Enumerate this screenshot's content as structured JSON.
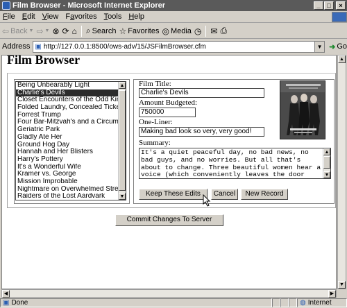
{
  "window": {
    "title": "Film Browser - Microsoft Internet Explorer",
    "buttons": {
      "minimize": "_",
      "maximize": "□",
      "close": "×"
    }
  },
  "menu": [
    {
      "prefix": "",
      "underline": "F",
      "rest": "ile"
    },
    {
      "prefix": "",
      "underline": "E",
      "rest": "dit"
    },
    {
      "prefix": "",
      "underline": "V",
      "rest": "iew"
    },
    {
      "prefix": "F",
      "underline": "a",
      "rest": "vorites"
    },
    {
      "prefix": "",
      "underline": "T",
      "rest": "ools"
    },
    {
      "prefix": "",
      "underline": "H",
      "rest": "elp"
    }
  ],
  "toolbar": {
    "back_label": "Back",
    "search_label": "Search",
    "favorites_label": "Favorites",
    "media_label": "Media"
  },
  "address": {
    "label": "Address",
    "url": "http://127.0.0.1:8500/ows-adv/15/JSFilmBrowser.cfm",
    "go_label": "Go"
  },
  "page": {
    "heading": "Film Browser"
  },
  "films": {
    "selected_index": 1,
    "items": [
      "Being Unbearably Light",
      "Charlie's Devils",
      "Closet Encounters of the Odd Kind",
      "Folded Laundry, Concealed Ticket",
      "Forrest Trump",
      "Four Bar-Mitzvah's and a Circumcision",
      "Geriatric Park",
      "Gladly Ate Her",
      "Ground Hog Day",
      "Hannah and Her Blisters",
      "Harry's Pottery",
      "It's a Wonderful Wife",
      "Kramer vs. George",
      "Mission Improbable",
      "Nightmare on Overwhelmed Street",
      "Raiders of the Lost Aardvark"
    ]
  },
  "form": {
    "title_label": "Film Title:",
    "title_value": "Charlie's Devils",
    "budget_label": "Amount Budgeted:",
    "budget_value": "750000",
    "oneliner_label": "One-Liner:",
    "oneliner_value": "Making bad look so very, very good!",
    "summary_label": "Summary:",
    "summary_value": "It's a quiet peaceful day, no bad news, no bad guys, and no worries. But all that's about to change. Three beautiful women hear a voice (which conveniently leaves the door open for an insanity"
  },
  "buttons": {
    "keep": "Keep These Edits",
    "cancel": "Cancel",
    "new": "New Record",
    "commit": "Commit Changes To Server"
  },
  "status": {
    "left": "Done",
    "zone": "Internet"
  }
}
